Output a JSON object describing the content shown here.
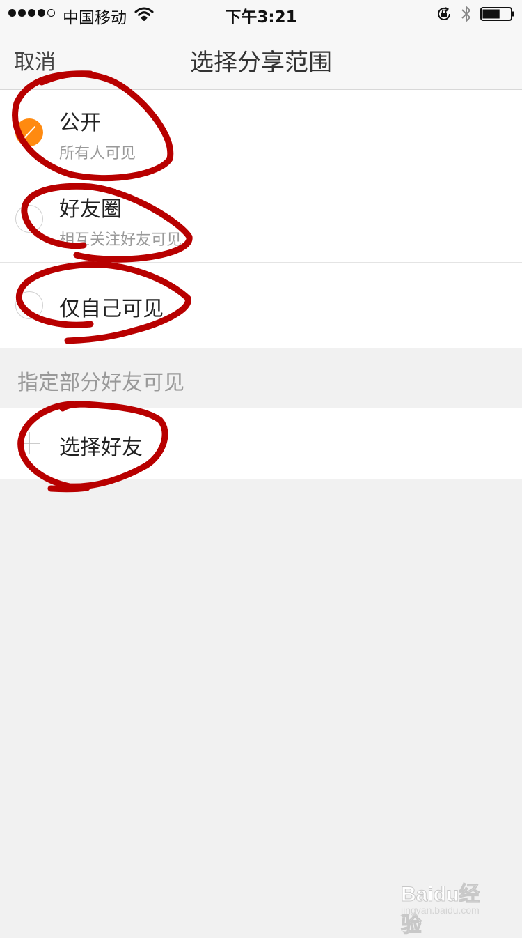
{
  "status_bar": {
    "carrier": "中国移动",
    "time": "下午3:21",
    "signal_bars_filled": 4,
    "signal_bars_total": 5,
    "battery_level": 0.62,
    "icons": [
      "wifi-icon",
      "orientation-lock-icon",
      "bluetooth-icon",
      "battery-icon"
    ]
  },
  "nav": {
    "cancel": "取消",
    "title": "选择分享范围"
  },
  "options": [
    {
      "title": "公开",
      "subtitle": "所有人可见",
      "selected": true
    },
    {
      "title": "好友圈",
      "subtitle": "相互关注好友可见",
      "selected": false
    },
    {
      "title": "仅自己可见",
      "subtitle": "",
      "selected": false
    }
  ],
  "section": {
    "header": "指定部分好友可见"
  },
  "choose_friends": {
    "label": "选择好友",
    "icon": "plus-icon"
  },
  "watermark": {
    "logo": "Baidu经验",
    "url": "jingyan.baidu.com"
  },
  "colors": {
    "accent": "#ff8a10",
    "annotation": "#b80000",
    "background": "#f1f1f1"
  }
}
